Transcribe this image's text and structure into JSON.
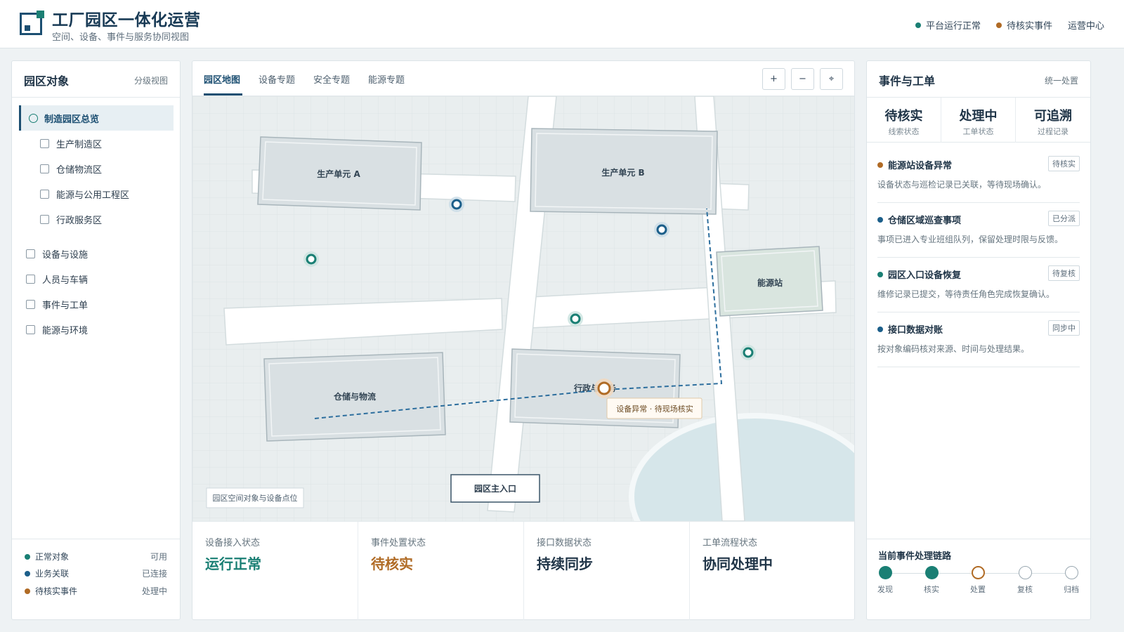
{
  "header": {
    "title": "工厂园区一体化运营",
    "subtitle": "空间、设备、事件与服务协同视图",
    "status": [
      {
        "label": "平台运行正常",
        "color": "#1a7f74"
      },
      {
        "label": "待核实事件",
        "color": "#b06b25"
      }
    ],
    "ops_center": "运营中心"
  },
  "left_panel": {
    "title": "园区对象",
    "action": "分级视图",
    "root": "制造园区总览",
    "zones": [
      "生产制造区",
      "仓储物流区",
      "能源与公用工程区",
      "行政服务区"
    ],
    "categories": [
      "设备与设施",
      "人员与车辆",
      "事件与工单",
      "能源与环境"
    ],
    "legend": [
      {
        "label": "正常对象",
        "value": "可用",
        "color": "#1a7f74"
      },
      {
        "label": "业务关联",
        "value": "已连接",
        "color": "#1c5f8a"
      },
      {
        "label": "待核实事件",
        "value": "处理中",
        "color": "#b06b25"
      }
    ]
  },
  "center": {
    "tabs": [
      "园区地图",
      "设备专题",
      "安全专题",
      "能源专题"
    ],
    "map_controls": {
      "zoom_in": "+",
      "zoom_out": "−",
      "locate": "⌖"
    },
    "buildings": {
      "unit_a": "生产单元 A",
      "unit_b": "生产单元 B",
      "energy": "能源站",
      "warehouse": "仓储与物流",
      "admin": "行政与服务"
    },
    "entrance": "园区主入口",
    "map_caption": "园区空间对象与设备点位",
    "alert_tooltip": "设备异常 · 待现场核实",
    "status_cards": [
      {
        "label": "设备接入状态",
        "value": "运行正常",
        "color": "#1a7f74"
      },
      {
        "label": "事件处置状态",
        "value": "待核实",
        "color": "#b06b25"
      },
      {
        "label": "接口数据状态",
        "value": "持续同步",
        "color": "#1f3447"
      },
      {
        "label": "工单流程状态",
        "value": "协同处理中",
        "color": "#1f3447"
      }
    ]
  },
  "right_panel": {
    "title": "事件与工单",
    "action": "统一处置",
    "kpis": [
      {
        "value": "待核实",
        "label": "线索状态"
      },
      {
        "value": "处理中",
        "label": "工单状态"
      },
      {
        "value": "可追溯",
        "label": "过程记录"
      }
    ],
    "events": [
      {
        "title": "能源站设备异常",
        "tag": "待核实",
        "desc": "设备状态与巡检记录已关联，等待现场确认。",
        "color": "#b06b25"
      },
      {
        "title": "仓储区域巡查事项",
        "tag": "已分派",
        "desc": "事项已进入专业班组队列，保留处理时限与反馈。",
        "color": "#1c5f8a"
      },
      {
        "title": "园区入口设备恢复",
        "tag": "待复核",
        "desc": "维修记录已提交，等待责任角色完成恢复确认。",
        "color": "#1a7f74"
      },
      {
        "title": "接口数据对账",
        "tag": "同步中",
        "desc": "按对象编码核对来源、时间与处理结果。",
        "color": "#1c5f8a"
      }
    ],
    "chain": {
      "title": "当前事件处理链路",
      "steps": [
        "发现",
        "核实",
        "处置",
        "复核",
        "归档"
      ]
    }
  }
}
